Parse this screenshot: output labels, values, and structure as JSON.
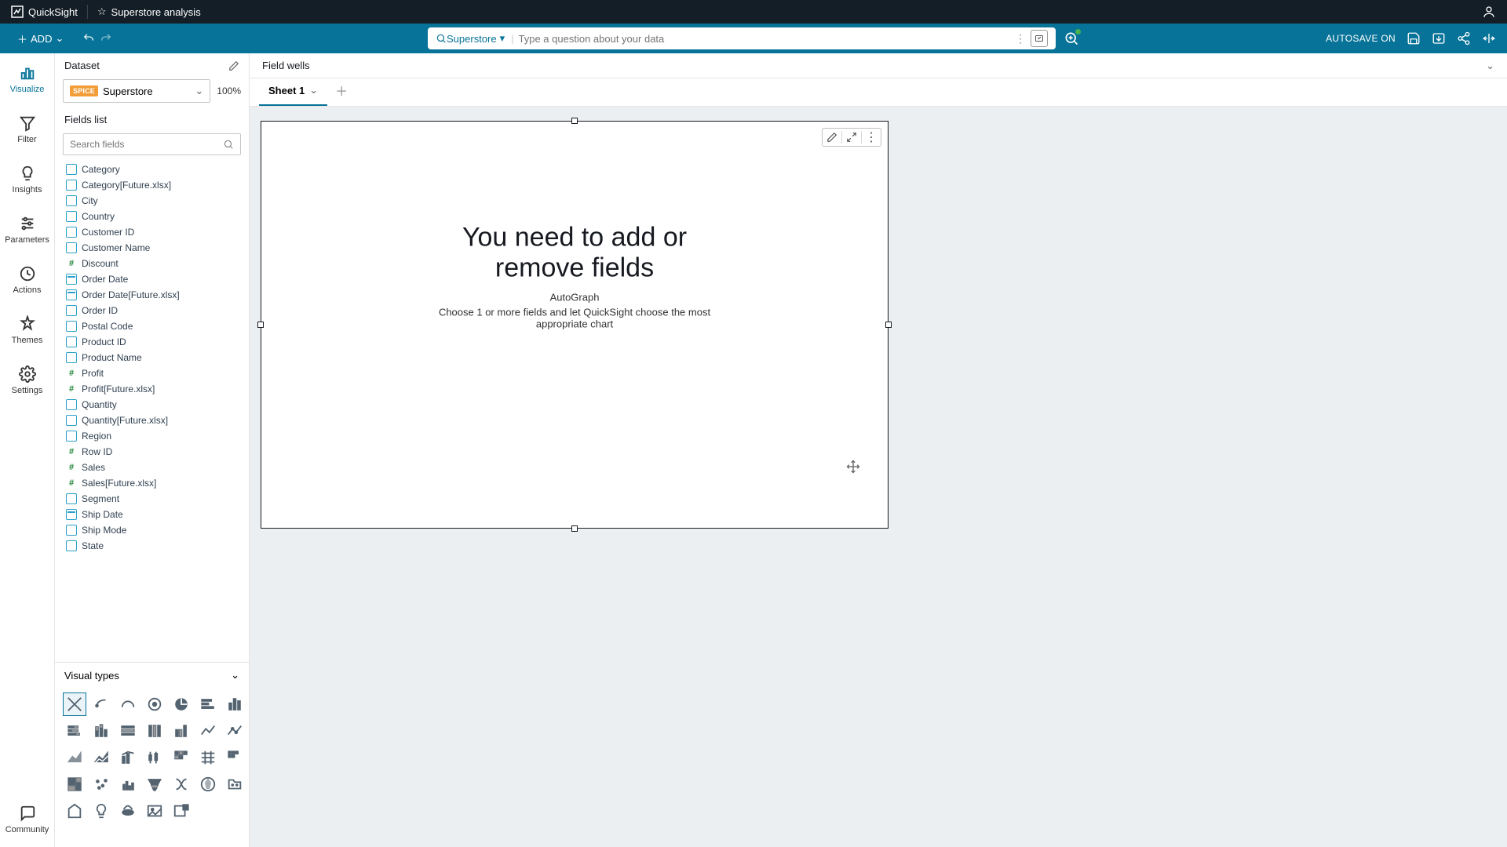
{
  "topbar": {
    "brand": "QuickSight",
    "analysis_title": "Superstore analysis"
  },
  "actionbar": {
    "add_label": "ADD",
    "search_dataset": "Superstore",
    "search_placeholder": "Type a question about your data",
    "autosave_label": "AUTOSAVE ON"
  },
  "rail": {
    "items": [
      {
        "label": "Visualize"
      },
      {
        "label": "Filter"
      },
      {
        "label": "Insights"
      },
      {
        "label": "Parameters"
      },
      {
        "label": "Actions"
      },
      {
        "label": "Themes"
      },
      {
        "label": "Settings"
      }
    ],
    "community_label": "Community"
  },
  "panel": {
    "dataset_header": "Dataset",
    "dataset_name": "Superstore",
    "dataset_badge": "SPICE",
    "dataset_pct": "100%",
    "fields_header": "Fields list",
    "search_placeholder": "Search fields",
    "fields": [
      {
        "name": "Category",
        "type": "dim"
      },
      {
        "name": "Category[Future.xlsx]",
        "type": "dim"
      },
      {
        "name": "City",
        "type": "dim"
      },
      {
        "name": "Country",
        "type": "dim"
      },
      {
        "name": "Customer ID",
        "type": "dim"
      },
      {
        "name": "Customer Name",
        "type": "dim"
      },
      {
        "name": "Discount",
        "type": "measure"
      },
      {
        "name": "Order Date",
        "type": "date"
      },
      {
        "name": "Order Date[Future.xlsx]",
        "type": "date"
      },
      {
        "name": "Order ID",
        "type": "dim"
      },
      {
        "name": "Postal Code",
        "type": "dim"
      },
      {
        "name": "Product ID",
        "type": "dim"
      },
      {
        "name": "Product Name",
        "type": "dim"
      },
      {
        "name": "Profit",
        "type": "measure"
      },
      {
        "name": "Profit[Future.xlsx]",
        "type": "measure"
      },
      {
        "name": "Quantity",
        "type": "dim"
      },
      {
        "name": "Quantity[Future.xlsx]",
        "type": "dim"
      },
      {
        "name": "Region",
        "type": "dim"
      },
      {
        "name": "Row ID",
        "type": "measure"
      },
      {
        "name": "Sales",
        "type": "measure"
      },
      {
        "name": "Sales[Future.xlsx]",
        "type": "measure"
      },
      {
        "name": "Segment",
        "type": "dim"
      },
      {
        "name": "Ship Date",
        "type": "date"
      },
      {
        "name": "Ship Mode",
        "type": "dim"
      },
      {
        "name": "State",
        "type": "dim"
      }
    ],
    "visual_types_header": "Visual types"
  },
  "canvas": {
    "field_wells_label": "Field wells",
    "sheet_name": "Sheet 1",
    "empty_heading": "You need to add or remove fields",
    "empty_sub1": "AutoGraph",
    "empty_sub2": "Choose 1 or more fields and let QuickSight choose the most appropriate chart"
  }
}
